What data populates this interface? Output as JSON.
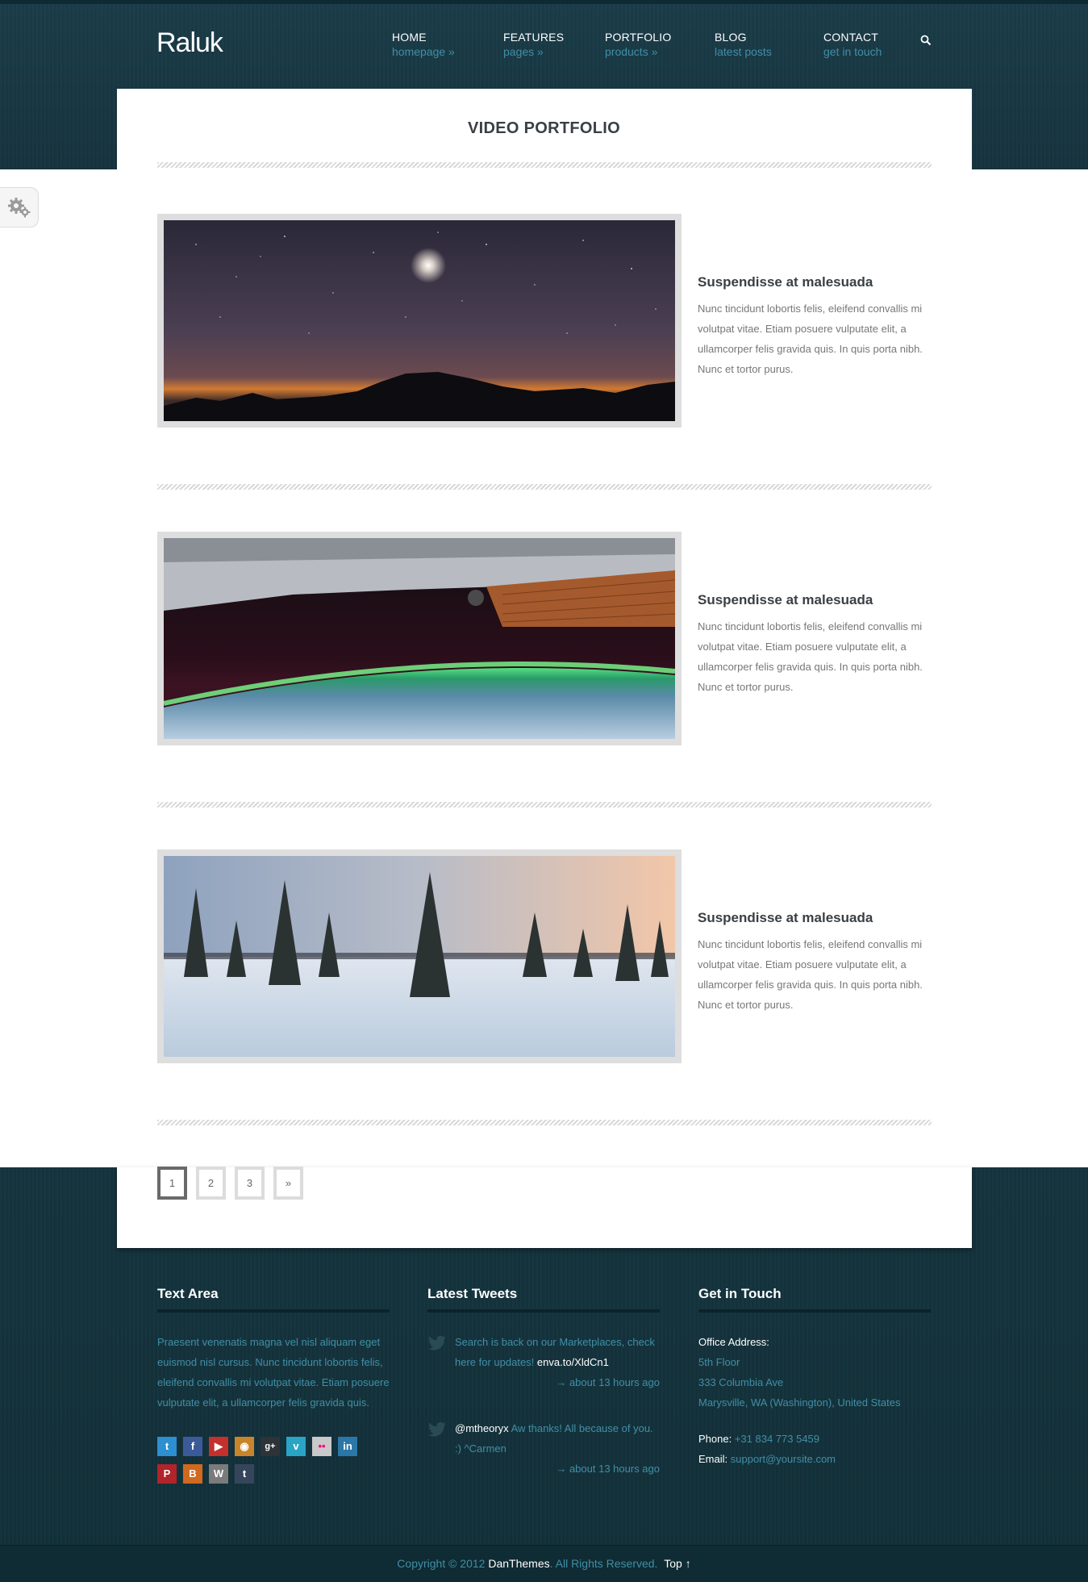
{
  "header": {
    "logo": "Raluk",
    "nav": [
      {
        "title": "HOME",
        "subtitle": "homepage »"
      },
      {
        "title": "FEATURES",
        "subtitle": "pages »"
      },
      {
        "title": "PORTFOLIO",
        "subtitle": "products »"
      },
      {
        "title": "BLOG",
        "subtitle": "latest posts"
      },
      {
        "title": "CONTACT",
        "subtitle": "get in touch"
      }
    ],
    "search_icon": "search-icon"
  },
  "page": {
    "title": "VIDEO PORTFOLIO",
    "settings_icon": "gear-icon"
  },
  "portfolio": {
    "items": [
      {
        "title": "Suspendisse at malesuada",
        "description": "Nunc tincidunt lobortis felis, eleifend convallis mi volutpat vitae. Etiam posuere vulputate elit, a ullamcorper felis gravida quis. In quis porta nibh. Nunc et tortor purus."
      },
      {
        "title": "Suspendisse at malesuada",
        "description": "Nunc tincidunt lobortis felis, eleifend convallis mi volutpat vitae. Etiam posuere vulputate elit, a ullamcorper felis gravida quis. In quis porta nibh. Nunc et tortor purus."
      },
      {
        "title": "Suspendisse at malesuada",
        "description": "Nunc tincidunt lobortis felis, eleifend convallis mi volutpat vitae. Etiam posuere vulputate elit, a ullamcorper felis gravida quis. In quis porta nibh. Nunc et tortor purus."
      }
    ]
  },
  "pagination": {
    "pages": [
      "1",
      "2",
      "3",
      "»"
    ],
    "active": "1"
  },
  "footer": {
    "text_area": {
      "title": "Text Area",
      "body": "Praesent venenatis magna vel nisl aliquam eget euismod nisl cursus. Nunc tincidunt lobortis felis, eleifend convallis mi volutpat vitae. Etiam posuere vulputate elit, a ullamcorper felis gravida quis.",
      "social": [
        "twitter-icon",
        "facebook-icon",
        "youtube-icon",
        "rss-icon",
        "googleplus-icon",
        "vimeo-icon",
        "flickr-icon",
        "linkedin-icon",
        "pinterest-icon",
        "blogger-icon",
        "wordpress-icon",
        "tumblr-icon"
      ]
    },
    "tweets": {
      "title": "Latest Tweets",
      "items": [
        {
          "text": "Search is back on our Marketplaces, check here for updates! ",
          "link": "enva.to/XldCn1",
          "time": "→ about 13 hours ago"
        },
        {
          "text": " Aw thanks! All because of you. :) ^Carmen",
          "mention": "@mtheoryx",
          "time": "→ about 13 hours ago"
        }
      ]
    },
    "contact": {
      "title": "Get in Touch",
      "address_label": "Office Address:",
      "address_line1": "5th Floor",
      "address_line2": "333 Columbia Ave",
      "address_line3": "Marysville, WA (Washington), United States",
      "phone_label": "Phone:",
      "phone": "+31 834 773 5459",
      "email_label": "Email:",
      "email": "support@yoursite.com"
    },
    "copyright": {
      "prefix": "Copyright © 2012 ",
      "brand": "DanThemes",
      "suffix": ". All Rights Reserved.",
      "top_link": "Top ↑"
    }
  },
  "colors": {
    "header_bg": "#1a3c48",
    "accent_link": "#3f8fa6",
    "footer_bg": "#15343e"
  }
}
